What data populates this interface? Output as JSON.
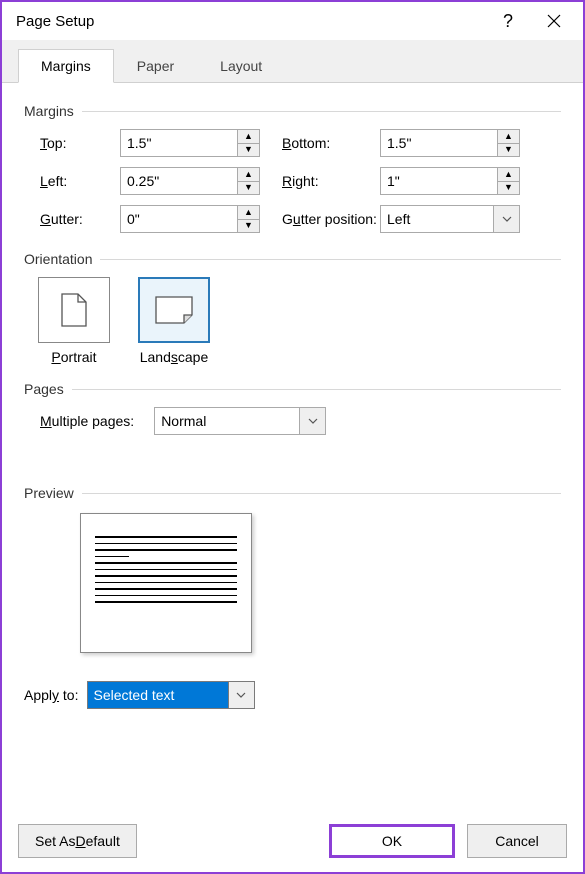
{
  "title": "Page Setup",
  "tabs": {
    "margins": "Margins",
    "paper": "Paper",
    "layout": "Layout"
  },
  "sections": {
    "margins": "Margins",
    "orientation": "Orientation",
    "pages": "Pages",
    "preview": "Preview"
  },
  "margin_labels": {
    "top": "Top:",
    "bottom": "Bottom:",
    "left": "Left:",
    "right": "Right:",
    "gutter": "Gutter:",
    "gutter_pos": "Gutter position:"
  },
  "margin_values": {
    "top": "1.5\"",
    "bottom": "1.5\"",
    "left": "0.25\"",
    "right": "1\"",
    "gutter": "0\"",
    "gutter_pos": "Left"
  },
  "orientation": {
    "portrait": "Portrait",
    "landscape": "Landscape"
  },
  "pages": {
    "multiple_label": "Multiple pages:",
    "multiple_value": "Normal"
  },
  "apply": {
    "label": "Apply to:",
    "value": "Selected text"
  },
  "buttons": {
    "default": "Set As Default",
    "ok": "OK",
    "cancel": "Cancel"
  }
}
